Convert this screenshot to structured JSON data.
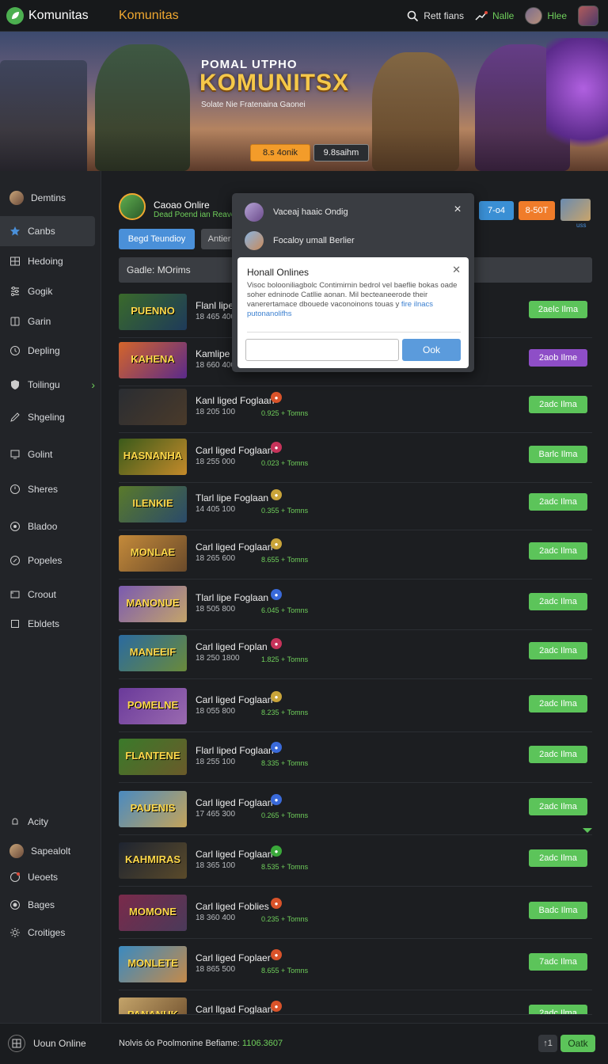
{
  "topbar": {
    "brand": "Komunitas",
    "title": "Komunitas",
    "search_label": "Rett fians",
    "notify_label": "Nalle",
    "profile_label": "Hlee"
  },
  "banner": {
    "subtitle": "POMAL UTPHO",
    "title": "KOMUNITSX",
    "tagline": "Solate Nie Fratenaina Gaonei",
    "primary_button": "8.s 4onik",
    "secondary_button": "9.8saihm"
  },
  "sidebar": {
    "items": [
      {
        "label": "Demtins",
        "icon": "avatar-icon"
      },
      {
        "label": "Canbs",
        "icon": "star-icon"
      },
      {
        "label": "Hedoing",
        "icon": "grid-icon"
      },
      {
        "label": "Gogik",
        "icon": "sliders-icon"
      },
      {
        "label": "Garin",
        "icon": "book-icon"
      },
      {
        "label": "Depling",
        "icon": "clock-icon"
      },
      {
        "label": "Toilingu",
        "icon": "shield-icon"
      },
      {
        "label": "Shgeling",
        "icon": "pen-icon"
      },
      {
        "label": "Golint",
        "icon": "monitor-icon"
      },
      {
        "label": "Sheres",
        "icon": "timer-icon"
      },
      {
        "label": "Bladoo",
        "icon": "target-icon"
      },
      {
        "label": "Popeles",
        "icon": "pin-icon"
      },
      {
        "label": "Croout",
        "icon": "tv-icon"
      },
      {
        "label": "Ebldets",
        "icon": "square-icon"
      }
    ],
    "bottom_items": [
      {
        "label": "Acity",
        "icon": "bell-icon"
      },
      {
        "label": "Sapealolt",
        "icon": "user-avatar"
      },
      {
        "label": "Ueoets",
        "icon": "alert-icon"
      },
      {
        "label": "Bages",
        "icon": "badge-icon"
      },
      {
        "label": "Croitiges",
        "icon": "gear-icon"
      }
    ]
  },
  "main": {
    "header_title": "Caoao Onlire",
    "header_sub": "Dead Poend ian Reaver",
    "tab_active": "Begd Teundioy",
    "tab_inactive": "Antier",
    "pill_blue": "7-o4",
    "pill_orange": "8-50T",
    "mini_caption": "uss",
    "filter_label": "Gadle: MOrims"
  },
  "rows": [
    {
      "thumb": "PUENNO",
      "title": "Flanl lipe",
      "sub": "18 465 400",
      "badge": "",
      "stat": "",
      "btn": "2aelc Ilma",
      "purple": false,
      "c1": "#3a6a2a",
      "c2": "#1e3a5a"
    },
    {
      "thumb": "KAHENA",
      "title": "Kamlipe",
      "sub": "18 660 400",
      "badge": "",
      "stat": "",
      "btn": "2aob Ilme",
      "purple": true,
      "c1": "#d4652a",
      "c2": "#5a2a8a"
    },
    {
      "thumb": "",
      "title": "Kanl liged Foglaan",
      "sub": "18 205 100",
      "badge": "●",
      "stat": "0.925 + Tomns",
      "btn": "2adc Ilma",
      "purple": false,
      "c1": "#2a2d32",
      "c2": "#4a3a2a"
    },
    {
      "thumb": "HASNANHA",
      "title": "Carl liged Foglaan",
      "sub": "18 255 000",
      "badge": "●",
      "stat": "0.023 + Tomns",
      "btn": "Barlc Ilma",
      "purple": false,
      "c1": "#3a5a1a",
      "c2": "#c48a2a"
    },
    {
      "thumb": "ILENKIE",
      "title": "Tlarl lipe Foglaan",
      "sub": "14 405 100",
      "badge": "●",
      "stat": "0.355 + Tomns",
      "btn": "2adc Ilma",
      "purple": false,
      "c1": "#5a7a2a",
      "c2": "#2a4a6a"
    },
    {
      "thumb": "MONLAE",
      "title": "Carl liged Foglaan",
      "sub": "18 265 600",
      "badge": "●",
      "stat": "8.655 + Tomns",
      "btn": "2adc Ilma",
      "purple": false,
      "c1": "#c48a3a",
      "c2": "#6a4a2a"
    },
    {
      "thumb": "MANONUE",
      "title": "Tlarl lipe Foglaan",
      "sub": "18 505 800",
      "badge": "●",
      "stat": "6.045 + Tomns",
      "btn": "2adc Ilma",
      "purple": false,
      "c1": "#7a5ab0",
      "c2": "#c4a46a"
    },
    {
      "thumb": "MANEEIF",
      "title": "Carl liged Foplan",
      "sub": "18 250 1800",
      "badge": "●",
      "stat": "1.825 + Tomns",
      "btn": "2adc Ilma",
      "purple": false,
      "c1": "#2a6aa0",
      "c2": "#6a8a3a"
    },
    {
      "thumb": "POMELNE",
      "title": "Carl liged Foglaan",
      "sub": "18 055 800",
      "badge": "●",
      "stat": "8.235 + Tomns",
      "btn": "2adc Ilma",
      "purple": false,
      "c1": "#6a3a9a",
      "c2": "#9a6ab0"
    },
    {
      "thumb": "FLANTENE",
      "title": "Flarl liped Foglaan",
      "sub": "18 255 100",
      "badge": "●",
      "stat": "8.335 + Tomns",
      "btn": "2adc Ilma",
      "purple": false,
      "c1": "#3a7a2a",
      "c2": "#6a5a2a"
    },
    {
      "thumb": "PAUENIS",
      "title": "Carl liged Foglaan",
      "sub": "17 465 300",
      "badge": "●",
      "stat": "0.265 + Tomns",
      "btn": "2adc Ilma",
      "purple": false,
      "c1": "#4a8ac0",
      "c2": "#c4a45a"
    },
    {
      "thumb": "KAHMIRAS",
      "title": "Carl liged Foglaan",
      "sub": "18 365 100",
      "badge": "●",
      "stat": "8.535 + Tomns",
      "btn": "2adc Ilma",
      "purple": false,
      "c1": "#1e2430",
      "c2": "#5a4a2a"
    },
    {
      "thumb": "MOMONE",
      "title": "Carl liged Foblies",
      "sub": "18 360 400",
      "badge": "●",
      "stat": "0.235 + Tomns",
      "btn": "Badc Ilma",
      "purple": false,
      "c1": "#7a2a4a",
      "c2": "#4a3a5a"
    },
    {
      "thumb": "MONLETE",
      "title": "Carl liged Foplaer",
      "sub": "18 865 500",
      "badge": "●",
      "stat": "8.655 + Tomns",
      "btn": "7adc Ilma",
      "purple": false,
      "c1": "#3a8ac0",
      "c2": "#c48a4a"
    },
    {
      "thumb": "PANANUK",
      "title": "Carl llgad Foglaan",
      "sub": "",
      "badge": "●",
      "stat": "",
      "btn": "2adc Ilma",
      "purple": false,
      "c1": "#c4a46a",
      "c2": "#6a4a2a"
    }
  ],
  "panel": {
    "row1": "Vaceaj haaic Ondig",
    "row2": "Focaloy umall Berlier"
  },
  "dialog": {
    "title": "Honall Onlines",
    "body": "Visoc bolooniliagbolc Contimirnin bedrol vel baeflie bokas oade soher edninode Catllie aonan. Mil becteaneerode their vanerertamace dbouede vaconoinons touas y",
    "link1": "fire ilnacs",
    "link2": "putonanolifhs",
    "ok_label": "Ook"
  },
  "footer": {
    "left_label": "Uoun Online",
    "note_prefix": "Nolvis óo Poolmonine Befiame:",
    "note_value": "1106.3607",
    "icon_label": "↑1",
    "ok_label": "Oatk"
  },
  "colors": {
    "accent_green": "#5cc45a",
    "accent_orange": "#f0a830",
    "accent_blue": "#4a90d9",
    "accent_purple": "#8e4ec7"
  }
}
